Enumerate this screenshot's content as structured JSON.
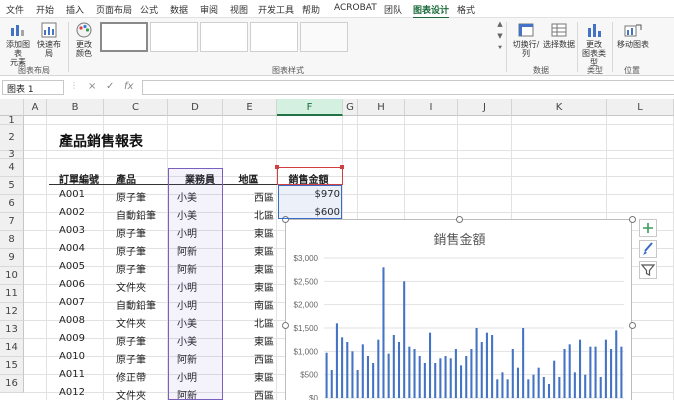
{
  "menu": [
    "文件",
    "开始",
    "插入",
    "页面布局",
    "公式",
    "数据",
    "审阅",
    "视图",
    "开发工具",
    "帮助",
    "ACROBAT",
    "团队",
    "图表设计",
    "格式"
  ],
  "menu_active_index": 12,
  "ribbon": {
    "add_element": "添加图表\n元素",
    "quick_layout": "快速布局",
    "change_color": "更改\n颜色",
    "switch_row_col": "切换行/列",
    "select_data": "选择数据",
    "change_type": "更改\n图表类型",
    "move_chart": "移动图表",
    "group_layout": "图表布局",
    "group_styles": "图表样式",
    "group_data": "数据",
    "group_type": "类型",
    "group_location": "位置"
  },
  "formula_bar": {
    "name_box": "图表 1",
    "cancel": "×",
    "enter": "✓",
    "fx": "fx",
    "value": ""
  },
  "columns": [
    "A",
    "B",
    "C",
    "D",
    "E",
    "F",
    "G",
    "H",
    "I",
    "J",
    "K",
    "L"
  ],
  "rows": [
    "1",
    "2",
    "3",
    "4",
    "5",
    "6",
    "7",
    "8",
    "9",
    "10",
    "11",
    "12",
    "13",
    "14",
    "15",
    "16"
  ],
  "sheet_title": "產品銷售報表",
  "table_headers": [
    "訂單編號",
    "產品",
    "業務員",
    "地區",
    "銷售金額"
  ],
  "table_rows": [
    [
      "A001",
      "原子筆",
      "小美",
      "西區",
      "$970"
    ],
    [
      "A002",
      "自動鉛筆",
      "小美",
      "北區",
      "$600"
    ],
    [
      "A003",
      "原子筆",
      "小明",
      "東區",
      ""
    ],
    [
      "A004",
      "原子筆",
      "阿新",
      "東區",
      ""
    ],
    [
      "A005",
      "原子筆",
      "阿新",
      "東區",
      ""
    ],
    [
      "A006",
      "文件夾",
      "小明",
      "東區",
      ""
    ],
    [
      "A007",
      "自動鉛筆",
      "小明",
      "南區",
      ""
    ],
    [
      "A008",
      "文件夾",
      "小美",
      "北區",
      ""
    ],
    [
      "A009",
      "原子筆",
      "小美",
      "東區",
      ""
    ],
    [
      "A010",
      "原子筆",
      "阿新",
      "西區",
      ""
    ],
    [
      "A011",
      "修正帶",
      "小明",
      "東區",
      ""
    ],
    [
      "A012",
      "文件夾",
      "阿新",
      "西區",
      ""
    ]
  ],
  "chart_data": {
    "type": "bar",
    "title": "銷售金額",
    "ylim": [
      0,
      3000
    ],
    "yticks": [
      "$0",
      "$500",
      "$1,000",
      "$1,500",
      "$2,000",
      "$2,500",
      "$3,000"
    ],
    "grid": true,
    "color": "#4472c4",
    "values": [
      970,
      600,
      1600,
      1300,
      1200,
      1000,
      600,
      1150,
      900,
      750,
      1250,
      2800,
      950,
      1350,
      1200,
      2500,
      1100,
      1050,
      900,
      750,
      1400,
      750,
      850,
      900,
      850,
      1050,
      700,
      900,
      1050,
      1500,
      1200,
      1400,
      1350,
      400,
      550,
      400,
      1050,
      650,
      1500,
      400,
      500,
      650,
      450,
      300,
      800,
      450,
      1050,
      1150,
      550,
      1250,
      500,
      1100,
      1100,
      450,
      1250,
      1050,
      1450,
      1100
    ]
  }
}
